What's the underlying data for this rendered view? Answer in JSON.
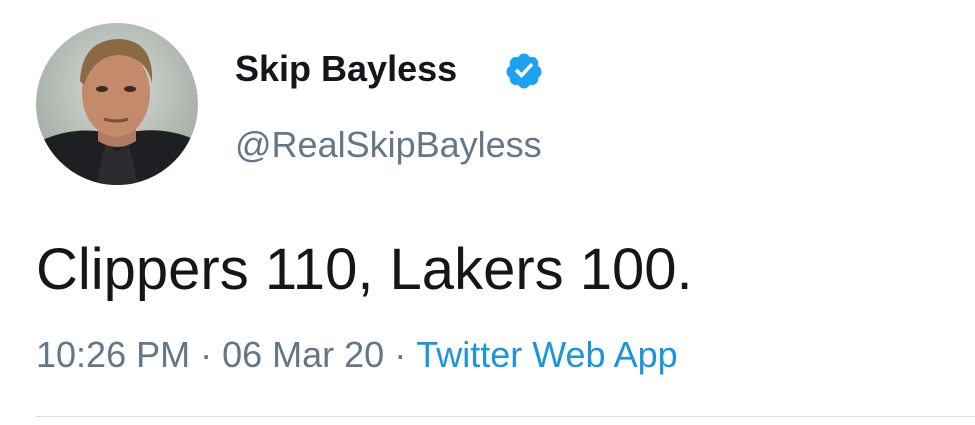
{
  "user": {
    "display_name": "Skip Bayless",
    "handle": "@RealSkipBayless",
    "verified_icon": "verified-badge-icon",
    "avatar_icon": "avatar-photo"
  },
  "tweet": {
    "text": "Clippers 110, Lakers 100.",
    "time": "10:26 PM",
    "separator": "·",
    "date": "06 Mar 20",
    "source": "Twitter Web App"
  },
  "colors": {
    "name": "#14171a",
    "secondary": "#657786",
    "link": "#1b95e0",
    "verified": "#1da1f2",
    "divider": "#d9dde1"
  }
}
